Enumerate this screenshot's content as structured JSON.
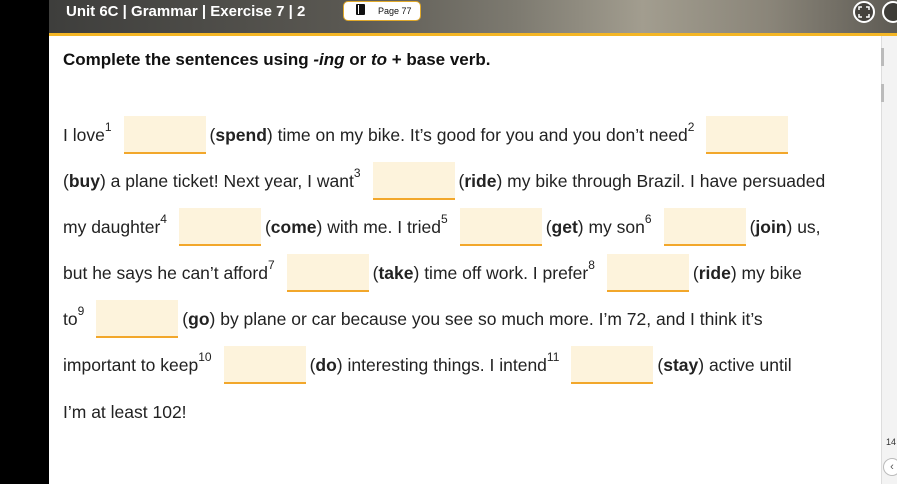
{
  "header": {
    "title": "Unit 6C | Grammar | Exercise 7 | 2",
    "page_button": "Page 77"
  },
  "instruction": {
    "part1": "Complete the sentences using ",
    "ing": "-ing",
    "part2": " or ",
    "to": "to",
    "part3": " + base verb."
  },
  "lines": [
    {
      "t1": "I love ",
      "n1": "1",
      "v1": "spend",
      "t2": ") time on my bike. It’s good for you and you don’t need ",
      "n2": "2"
    },
    {
      "v1": "buy",
      "t1": ") a plane ticket! Next year, I want ",
      "n1": "3",
      "v2": "ride",
      "t2": ") my bike through Brazil. I have persuaded"
    },
    {
      "t1": "my daughter ",
      "n1": "4",
      "v1": "come",
      "t2": ") with me. I tried ",
      "n2": "5",
      "v2": "get",
      "t3": ") my son ",
      "n3": "6",
      "v3": "join",
      "t4": ") us,"
    },
    {
      "t1": "but he says he can’t afford ",
      "n1": "7",
      "v1": "take",
      "t2": ") time off work. I prefer ",
      "n2": "8",
      "v2": "ride",
      "t3": ") my bike"
    },
    {
      "t1": "to ",
      "n1": "9",
      "v1": "go",
      "t2": ") by plane or car because you see so much more. I’m 72, and I think it’s"
    },
    {
      "t1": "important to keep ",
      "n1": "10",
      "v1": "do",
      "t2": ") interesting things. I intend ",
      "n2": "11",
      "v2": "stay",
      "t3": ") active until"
    },
    {
      "t1": "I’m at least 102!"
    }
  ],
  "sidebar": {
    "page_number": "14"
  }
}
